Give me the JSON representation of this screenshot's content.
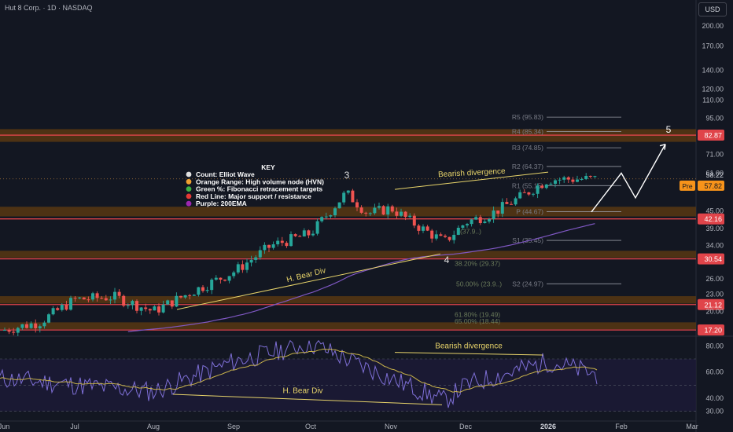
{
  "header": {
    "symbol_title": "Hut 8 Corp. · 1D · NASDAQ",
    "currency_button": "USD"
  },
  "colors": {
    "background": "#131722",
    "up": "#26a69a",
    "down": "#ef5350",
    "hvn_zone": "#5d3a12",
    "support_line": "#e0444a",
    "ema200": "#7e57c2",
    "annotation": "#e8d46a",
    "wave_projection": "#ffffff",
    "pivot_line": "#9598a1",
    "rsi_line": "#7e6fd6",
    "rsi_ma": "#c8b24a"
  },
  "key_legend": {
    "title": "KEY",
    "items": [
      {
        "text": "Count: Elliot Wave",
        "color": "#e0e0e0"
      },
      {
        "text": "Orange Range: High volume node (HVN)",
        "color": "#f0a030"
      },
      {
        "text": "Green %: Fibonacci retracement targets",
        "color": "#3cb043"
      },
      {
        "text": "Red Line: Major support / resistance",
        "color": "#e53935"
      },
      {
        "text": "Purple: 200EMA",
        "color": "#9c27b0"
      }
    ]
  },
  "price_axis": {
    "ticks": [
      "200.00",
      "170.00",
      "140.00",
      "120.00",
      "110.00",
      "95.00",
      "82.87",
      "71.00",
      "61.00",
      "58.22",
      "57.82",
      "45.00",
      "42.16",
      "39.00",
      "34.00",
      "30.54",
      "26.00",
      "23.00",
      "21.12",
      "20.00",
      "17.20"
    ],
    "last_price": "58.22",
    "premarket_label": "Pre",
    "premarket_price": "57.82"
  },
  "time_axis": [
    "Jun",
    "Jul",
    "Aug",
    "Sep",
    "Oct",
    "Nov",
    "Dec",
    "2026",
    "Feb",
    "Mar"
  ],
  "levels": {
    "support_resistance": [
      {
        "price": 82.87,
        "label": "82.87"
      },
      {
        "price": 42.16,
        "label": "42.16"
      },
      {
        "price": 30.54,
        "label": "30.54"
      },
      {
        "price": 21.12,
        "label": "21.12"
      },
      {
        "price": 17.2,
        "label": "17.20"
      }
    ],
    "pivots": [
      {
        "label": "R5 (95.83)",
        "price": 95.83
      },
      {
        "label": "R4 (85.34)",
        "price": 85.34
      },
      {
        "label": "R3 (74.85)",
        "price": 74.85
      },
      {
        "label": "R2 (64.37)",
        "price": 64.37
      },
      {
        "label": "R1 (55.15)",
        "price": 55.15
      },
      {
        "label": "P (44.67)",
        "price": 44.67
      },
      {
        "label": "S1 (35.45)",
        "price": 35.45
      },
      {
        "label": "S2 (24.97)",
        "price": 24.97
      }
    ],
    "fibs": [
      {
        "label": "(37.9..)",
        "price": 38.2
      },
      {
        "label": "38.20% (29.37)",
        "price": 29.37
      },
      {
        "label": "50.00% (23.9..)",
        "price": 24.97
      },
      {
        "label": "61.80% (19.49)",
        "price": 19.49
      },
      {
        "label": "65.00% (18.44)",
        "price": 18.44
      }
    ]
  },
  "annotations": {
    "wave3": "3",
    "wave4": "4",
    "wave5": "5",
    "bearish_divergence_price": "Bearish divergence",
    "hidden_bear_div_price": "H. Bear Div",
    "bearish_divergence_rsi": "Bearish divergence",
    "hidden_bear_div_rsi": "H. Bear Div"
  },
  "rsi_axis": [
    "80.00",
    "60.00",
    "40.00",
    "30.00"
  ],
  "chart_data": {
    "type": "candlestick",
    "title": "Hut 8 Corp. · 1D · NASDAQ",
    "price_scale": "log",
    "ylim": [
      17,
      220
    ],
    "x_range": [
      "Jun",
      "Mar"
    ],
    "closes_approx": [
      {
        "date": "Jun",
        "close": 17.2
      },
      {
        "date": "mid-Jun",
        "close": 18.3
      },
      {
        "date": "Jul",
        "close": 22.0
      },
      {
        "date": "mid-Jul",
        "close": 22.5
      },
      {
        "date": "Aug",
        "close": 20.0
      },
      {
        "date": "mid-Aug",
        "close": 23.5
      },
      {
        "date": "Sep",
        "close": 27.5
      },
      {
        "date": "mid-Sep",
        "close": 34.0
      },
      {
        "date": "Oct",
        "close": 37.5
      },
      {
        "date": "mid-Oct",
        "close": 52.0
      },
      {
        "date": "late-Oct",
        "close": 44.0
      },
      {
        "date": "Nov",
        "close": 46.0
      },
      {
        "date": "mid-Nov",
        "close": 40.0
      },
      {
        "date": "late-Nov",
        "close": 35.0
      },
      {
        "date": "Dec",
        "close": 41.0
      },
      {
        "date": "mid-Dec",
        "close": 44.0
      },
      {
        "date": "late-Dec",
        "close": 50.0
      },
      {
        "date": "2026",
        "close": 58.0
      },
      {
        "date": "mid-Jan",
        "close": 58.22
      }
    ],
    "last_close": 58.22,
    "premarket": 57.82,
    "rsi": {
      "ylim": [
        25,
        85
      ],
      "levels": [
        70,
        50,
        30
      ],
      "values_approx": [
        {
          "date": "Jun",
          "value": 55
        },
        {
          "date": "Aug",
          "value": 45
        },
        {
          "date": "Sep",
          "value": 68
        },
        {
          "date": "Oct",
          "value": 82
        },
        {
          "date": "Nov",
          "value": 55
        },
        {
          "date": "late-Nov",
          "value": 38
        },
        {
          "date": "Dec",
          "value": 50
        },
        {
          "date": "2026",
          "value": 68
        },
        {
          "date": "mid-Jan",
          "value": 58
        }
      ]
    }
  }
}
